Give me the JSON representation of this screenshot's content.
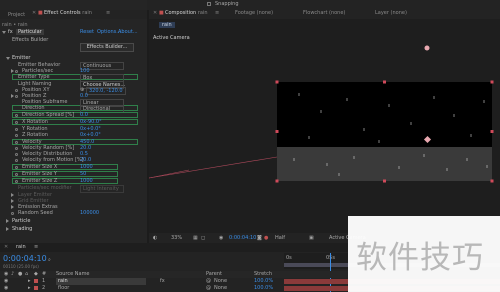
{
  "left_tabs": {
    "project": "Project",
    "effect_controls": "Effect Controls",
    "effect_controls_suffix": "rain",
    "menu_icon": "menu-icon"
  },
  "layer_path": "rain • rain",
  "effect": {
    "name": "Particular",
    "reset": "Reset",
    "options": "Options...",
    "about": "About...",
    "builder_label": "Effects Builder",
    "builder_button": "Effects Builder..."
  },
  "params": [
    {
      "label": "Emitter",
      "value": ""
    },
    {
      "label": "Emitter Behavior",
      "value": "Continuous"
    },
    {
      "label": "Particles/sec",
      "value": "100"
    },
    {
      "label": "Emitter Type",
      "value": "Box"
    },
    {
      "label": "Light Naming",
      "value": "Choose Names..."
    },
    {
      "label": "Position XY",
      "value": "320.0, -120.0"
    },
    {
      "label": "Position Z",
      "value": "0.0"
    },
    {
      "label": "Position Subframe",
      "value": "Linear"
    },
    {
      "label": "Direction",
      "value": "Directional"
    },
    {
      "label": "Direction Spread [%]",
      "value": "0.0"
    },
    {
      "label": "X Rotation",
      "value": "0x-90.0°"
    },
    {
      "label": "Y Rotation",
      "value": "0x+0.0°"
    },
    {
      "label": "Z Rotation",
      "value": "0x+0.0°"
    },
    {
      "label": "Velocity",
      "value": "450.0"
    },
    {
      "label": "Velocity Random [%]",
      "value": "20.0"
    },
    {
      "label": "Velocity Distribution",
      "value": "0.5"
    },
    {
      "label": "Velocity from Motion [%]",
      "value": "20.0"
    },
    {
      "label": "Emitter Size X",
      "value": "1000"
    },
    {
      "label": "Emitter Size Y",
      "value": "50"
    },
    {
      "label": "Emitter Size Z",
      "value": "1000"
    },
    {
      "label": "Particles/sec modifier",
      "value": "Light Intensity"
    },
    {
      "label": "Layer Emitter",
      "value": ""
    },
    {
      "label": "Grid Emitter",
      "value": ""
    },
    {
      "label": "Emission Extras",
      "value": ""
    },
    {
      "label": "Random Seed",
      "value": "100000"
    },
    {
      "label": "Particle",
      "value": ""
    },
    {
      "label": "Shading",
      "value": ""
    }
  ],
  "right_tabs": {
    "composition": "Composition",
    "comp_name": "rain",
    "footage": "Footage (none)",
    "flowchart": "Flowchart (none)",
    "layer": "Layer (none)"
  },
  "top_toolbar": {
    "snapping": "Snapping"
  },
  "comp_tab": "rain",
  "active_camera": "Active Camera",
  "viewer_footer": {
    "zoom": "33%",
    "time": "0:00:04:10",
    "resolution": "Half",
    "camera": "Active Camera"
  },
  "timeline": {
    "comp_tab": "rain",
    "timecode": "0:00:04:10",
    "frame_info": "00110 (25.00 fps)",
    "columns": {
      "source_name": "Source Name",
      "parent": "Parent",
      "stretch": "Stretch"
    },
    "layers": [
      {
        "num": "1",
        "name": "rain",
        "parent": "None",
        "stretch": "100.0%"
      },
      {
        "num": "2",
        "name": "floor",
        "parent": "None",
        "stretch": "100.0%"
      }
    ],
    "ruler": [
      "0s",
      "05s"
    ]
  },
  "watermark": "软件技巧"
}
